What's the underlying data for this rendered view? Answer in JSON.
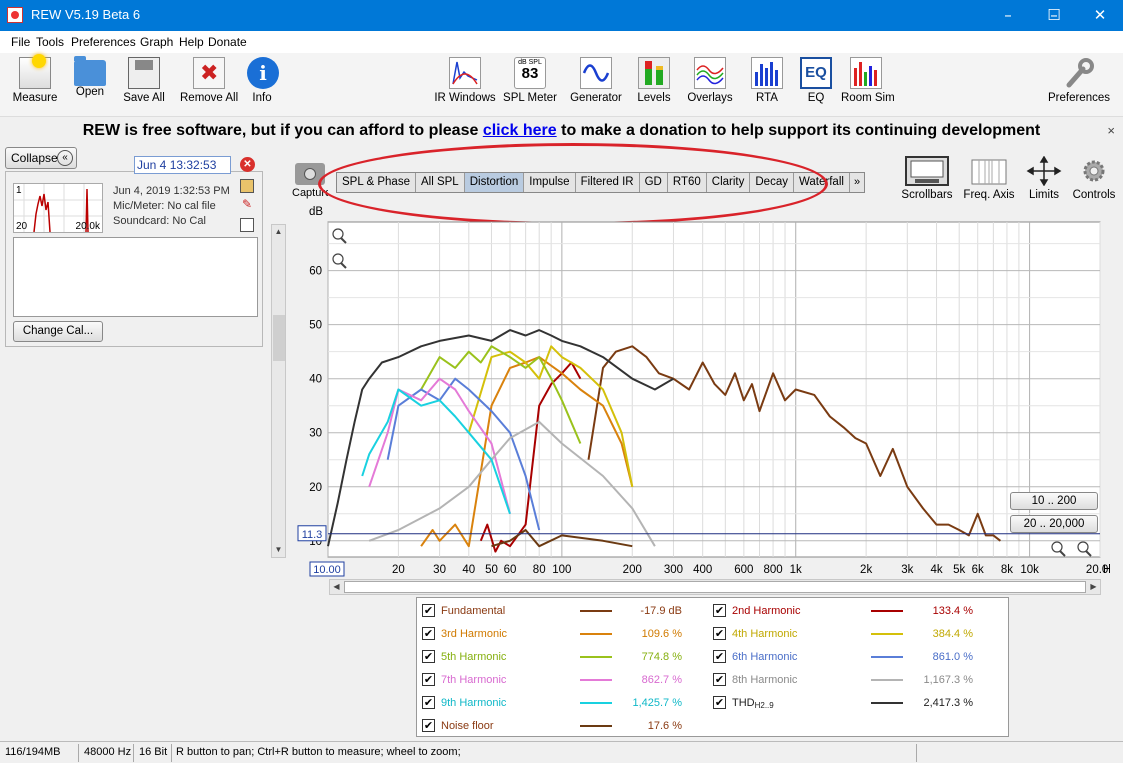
{
  "window": {
    "title": "REW V5.19 Beta 6",
    "minimize": "–",
    "maximize": "☐",
    "close": "✕"
  },
  "menu": [
    "File",
    "Tools",
    "Preferences",
    "Graph",
    "Help",
    "Donate"
  ],
  "toolbar": {
    "left": [
      "Measure",
      "Open",
      "Save All",
      "Remove All",
      "Info"
    ],
    "center": [
      "IR Windows",
      "SPL Meter",
      "Generator",
      "Levels",
      "Overlays",
      "RTA",
      "EQ",
      "Room Sim"
    ],
    "right": "Preferences",
    "spl_meter_value": "83",
    "spl_meter_unit": "dB SPL",
    "info_glyph": "i",
    "eq_glyph": "EQ"
  },
  "banner": {
    "before": "REW is free software, but if you can afford to please",
    "link": "click here",
    "after": "to make a donation to help support its continuing development",
    "close": "×"
  },
  "left_panel": {
    "collapse_label": "Collapse",
    "collapse_glyph": "«",
    "date_field": "Jun 4 13:32:53",
    "measurement": {
      "index": "1",
      "thumb_min": "20",
      "thumb_max": "20.0k",
      "timestamp": "Jun 4, 2019 1:32:53 PM",
      "mic_meter": "Mic/Meter: No cal file",
      "soundcard": "Soundcard: No Cal"
    },
    "change_cal_label": "Change Cal..."
  },
  "graph": {
    "capture_label": "Capture",
    "tabs": [
      "SPL & Phase",
      "All SPL",
      "Distortion",
      "Impulse",
      "Filtered IR",
      "GD",
      "RT60",
      "Clarity",
      "Decay",
      "Waterfall"
    ],
    "active_tab": "Distortion",
    "tabs_more": "»",
    "right_controls": [
      "Scrollbars",
      "Freq. Axis",
      "Limits",
      "Controls"
    ],
    "range_buttons": [
      "10 .. 200",
      "20 .. 20,000"
    ],
    "cursor_level": "11.3",
    "x_start_label": "10.00",
    "y_unit": "dB",
    "x_unit": "Hz"
  },
  "chart_data": {
    "type": "line",
    "title": "",
    "xlabel": "Hz",
    "ylabel": "dB",
    "x_scale": "log",
    "xlim": [
      10,
      20000
    ],
    "ylim": [
      7,
      69
    ],
    "y_ticks": [
      10,
      20,
      30,
      40,
      50,
      60
    ],
    "x_ticks": [
      {
        "v": 20,
        "l": "20"
      },
      {
        "v": 30,
        "l": "30"
      },
      {
        "v": 40,
        "l": "40"
      },
      {
        "v": 50,
        "l": "50"
      },
      {
        "v": 60,
        "l": "60"
      },
      {
        "v": 80,
        "l": "80"
      },
      {
        "v": 100,
        "l": "100"
      },
      {
        "v": 200,
        "l": "200"
      },
      {
        "v": 300,
        "l": "300"
      },
      {
        "v": 400,
        "l": "400"
      },
      {
        "v": 600,
        "l": "600"
      },
      {
        "v": 800,
        "l": "800"
      },
      {
        "v": 1000,
        "l": "1k"
      },
      {
        "v": 2000,
        "l": "2k"
      },
      {
        "v": 3000,
        "l": "3k"
      },
      {
        "v": 4000,
        "l": "4k"
      },
      {
        "v": 5000,
        "l": "5k"
      },
      {
        "v": 6000,
        "l": "6k"
      },
      {
        "v": 8000,
        "l": "8k"
      },
      {
        "v": 10000,
        "l": "10k"
      },
      {
        "v": 20000,
        "l": "20.0k"
      }
    ],
    "grid": true,
    "series": [
      {
        "name": "Fundamental",
        "color": "#7a3b12",
        "x": [
          130,
          150,
          170,
          200,
          230,
          260,
          300,
          350,
          400,
          450,
          500,
          550,
          600,
          650,
          700,
          800,
          900,
          1000,
          1200,
          1400,
          1600,
          1800,
          2000,
          2300,
          2600,
          3000,
          3500,
          4000,
          4500,
          5000,
          5500,
          6000,
          6500,
          7000,
          7500
        ],
        "y": [
          25,
          42,
          45,
          46,
          44,
          41,
          40,
          38,
          43,
          39,
          37,
          41,
          36,
          39,
          34,
          41,
          36,
          38,
          37,
          33,
          31,
          29,
          28,
          22,
          27,
          20,
          16,
          13,
          13,
          12,
          11,
          15,
          11,
          11,
          10
        ]
      },
      {
        "name": "2nd Harmonic",
        "color": "#a80000",
        "x": [
          45,
          48,
          52,
          55,
          60,
          70,
          80,
          90,
          100,
          110,
          120
        ],
        "y": [
          10,
          13,
          8,
          10,
          9,
          13,
          35,
          39,
          41,
          43,
          40
        ]
      },
      {
        "name": "3rd Harmonic",
        "color": "#d9820d",
        "x": [
          25,
          28,
          30,
          35,
          40,
          50,
          60,
          70,
          80,
          100,
          120,
          150,
          180,
          200
        ],
        "y": [
          9,
          12,
          10,
          13,
          9,
          35,
          42,
          43,
          44,
          41,
          38,
          35,
          28,
          20
        ]
      },
      {
        "name": "4th Harmonic",
        "color": "#d4c00a",
        "x": [
          40,
          50,
          60,
          70,
          80,
          90,
          100,
          120,
          150,
          180,
          200
        ],
        "y": [
          30,
          44,
          45,
          43,
          40,
          46,
          44,
          42,
          38,
          30,
          20
        ]
      },
      {
        "name": "5th Harmonic",
        "color": "#9ac21c",
        "x": [
          25,
          30,
          35,
          40,
          45,
          50,
          60,
          70,
          80,
          90,
          100,
          120
        ],
        "y": [
          38,
          44,
          42,
          45,
          43,
          46,
          44,
          42,
          44,
          40,
          36,
          28
        ]
      },
      {
        "name": "6th Harmonic",
        "color": "#5a7ed8",
        "x": [
          18,
          20,
          25,
          30,
          35,
          40,
          50,
          60,
          70,
          80
        ],
        "y": [
          25,
          35,
          38,
          36,
          40,
          38,
          34,
          30,
          22,
          12
        ]
      },
      {
        "name": "7th Harmonic",
        "color": "#e47ad7",
        "x": [
          15,
          18,
          20,
          25,
          30,
          35,
          40,
          50,
          60
        ],
        "y": [
          20,
          30,
          38,
          36,
          40,
          38,
          34,
          28,
          15
        ]
      },
      {
        "name": "8th Harmonic",
        "color": "#b4b4b4",
        "x": [
          15,
          20,
          30,
          40,
          50,
          60,
          80,
          100,
          150,
          200,
          250
        ],
        "y": [
          10,
          12,
          16,
          20,
          25,
          29,
          32,
          28,
          22,
          16,
          9
        ]
      },
      {
        "name": "9th Harmonic",
        "color": "#19d1e0",
        "x": [
          14,
          15,
          18,
          20,
          25,
          30,
          35,
          40,
          50,
          60
        ],
        "y": [
          22,
          26,
          32,
          38,
          35,
          36,
          33,
          30,
          25,
          15
        ]
      },
      {
        "name": "Noise floor",
        "color": "#6b3a12",
        "x": [
          50,
          60,
          70,
          80,
          100,
          150,
          200
        ],
        "y": [
          9,
          10,
          12,
          9,
          11,
          10,
          9
        ]
      },
      {
        "name": "THDH2..9",
        "color": "#333333",
        "x": [
          10,
          11,
          12,
          13,
          14,
          15,
          17,
          20,
          25,
          30,
          40,
          50,
          60,
          70,
          80,
          90,
          100,
          120,
          150,
          200,
          250,
          300
        ],
        "y": [
          9,
          17,
          25,
          32,
          38,
          40,
          43,
          44,
          46,
          47,
          48,
          47,
          49,
          48,
          49,
          48,
          47,
          46,
          44,
          40,
          38,
          40
        ]
      }
    ]
  },
  "legend": {
    "check": "✔",
    "items": [
      {
        "name": "Fundamental",
        "value": "-17.9 dB",
        "color": "#7a3b12",
        "text_color": "#8a3a12"
      },
      {
        "name": "2nd Harmonic",
        "value": "133.4 %",
        "color": "#a80000",
        "text_color": "#a80000"
      },
      {
        "name": "3rd Harmonic",
        "value": "109.6 %",
        "color": "#d9820d",
        "text_color": "#d07a00"
      },
      {
        "name": "4th Harmonic",
        "value": "384.4 %",
        "color": "#d4c00a",
        "text_color": "#c0a800"
      },
      {
        "name": "5th Harmonic",
        "value": "774.8 %",
        "color": "#9ac21c",
        "text_color": "#86b010"
      },
      {
        "name": "6th Harmonic",
        "value": "861.0 %",
        "color": "#5a7ed8",
        "text_color": "#4a6ec8"
      },
      {
        "name": "7th Harmonic",
        "value": "862.7 %",
        "color": "#e47ad7",
        "text_color": "#d86ad0"
      },
      {
        "name": "8th Harmonic",
        "value": "1,167.3 %",
        "color": "#b4b4b4",
        "text_color": "#8a8a8a"
      },
      {
        "name": "9th Harmonic",
        "value": "1,425.7 %",
        "color": "#19d1e0",
        "text_color": "#10b8c8"
      },
      {
        "name": "THD",
        "name_sub": "H2..9",
        "value": "2,417.3 %",
        "color": "#333333",
        "text_color": "#222222"
      },
      {
        "name": "Noise floor",
        "value": "17.6 %",
        "color": "#6b3a12",
        "text_color": "#8a3a12"
      }
    ]
  },
  "status": {
    "memory": "116/194MB",
    "sample_rate": "48000 Hz",
    "bits": "16 Bit",
    "hint": "R button to pan; Ctrl+R button to measure; wheel to zoom;"
  }
}
